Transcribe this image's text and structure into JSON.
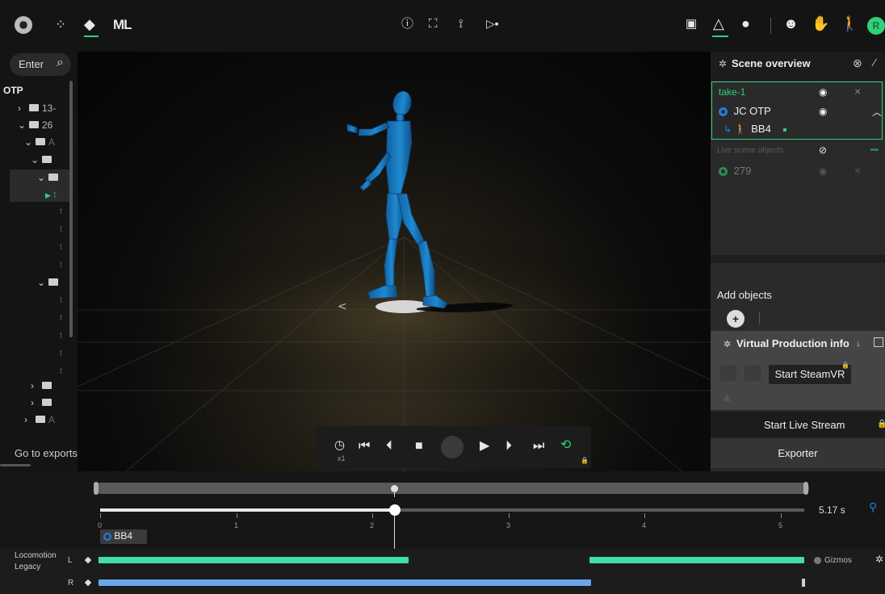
{
  "topbar": {
    "left_icons": [
      "app-logo-icon",
      "grid-dots-icon",
      "layers-icon"
    ],
    "ml_label": "ML",
    "center_icons": [
      "info-icon",
      "body-scan-icon",
      "pose-icon",
      "stream-icon"
    ],
    "right_icons": [
      "clapper-icon",
      "cone-lock-icon",
      "sphere-lock-icon",
      "avatar-lock-icon",
      "hand-icon",
      "figure-icon",
      "user-icon"
    ],
    "user_initial": "R",
    "accent_color": "#2fd17a"
  },
  "sidebar": {
    "search_label": "Enter",
    "root_label": "OTP",
    "items": [
      {
        "label": "13-"
      },
      {
        "label": "26"
      },
      {
        "label": "A"
      },
      {
        "label": ""
      },
      {
        "label": ""
      },
      {
        "label": "t"
      }
    ],
    "go_to_exports": "Go to exports"
  },
  "scene": {
    "title": "Scene overview",
    "take_label": "take-1",
    "actor_label": "JC OTP",
    "character_label": "BB4",
    "live_objects_label": "Live scene objects",
    "live_object_id": "279",
    "add_objects_label": "Add objects",
    "vp_info_title": "Virtual Production info",
    "steamvr_label": "Start SteamVR",
    "live_stream_label": "Start Live Stream",
    "exporter_label": "Exporter"
  },
  "playback": {
    "speed_label": "x1"
  },
  "timeline": {
    "tick_labels": [
      "0",
      "1",
      "2",
      "3",
      "4",
      "5"
    ],
    "duration_label": "5.17 s",
    "current_time_s": 2.2,
    "character_chip": "BB4",
    "track_name_line1": "Locomotion",
    "track_name_line2": "Legacy",
    "left_label": "L",
    "right_label": "R",
    "gizmos_label": "Gizmos"
  }
}
